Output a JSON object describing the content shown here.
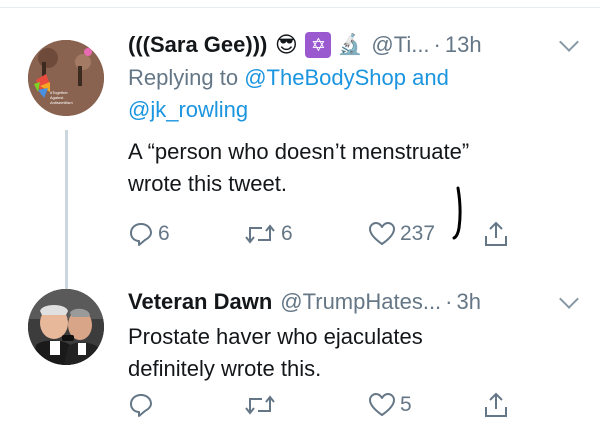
{
  "tweets": [
    {
      "display_name": "(((Sara Gee)))",
      "emojis": [
        "😎",
        "✡",
        "🔬"
      ],
      "handle": "@Ti...",
      "separator": "·",
      "time": "13h",
      "reply_prefix": "Replying to",
      "reply_mention_1": "@TheBodyShop",
      "reply_and": "and",
      "reply_mention_2": "@jk_rowling",
      "text_line_1": "A “person who doesn’t menstruate”",
      "text_line_2": "wrote this tweet.",
      "reply_count": "6",
      "retweet_count": "6",
      "like_count": "237",
      "avatar_caption": "#Together Against Antisemitism"
    },
    {
      "display_name": "Veteran Dawn",
      "handle": "@TrumpHates...",
      "separator": "·",
      "time": "3h",
      "text_line_1": "Prostate haver who ejaculates",
      "text_line_2": "definitely wrote this.",
      "like_count": "5"
    }
  ],
  "colors": {
    "link": "#1b95e0",
    "secondary": "#657786",
    "primary_text": "#14171a",
    "thread_line": "#ccd6dd"
  },
  "icons": [
    "reply-icon",
    "retweet-icon",
    "like-icon",
    "share-icon",
    "chevron-down-icon"
  ]
}
